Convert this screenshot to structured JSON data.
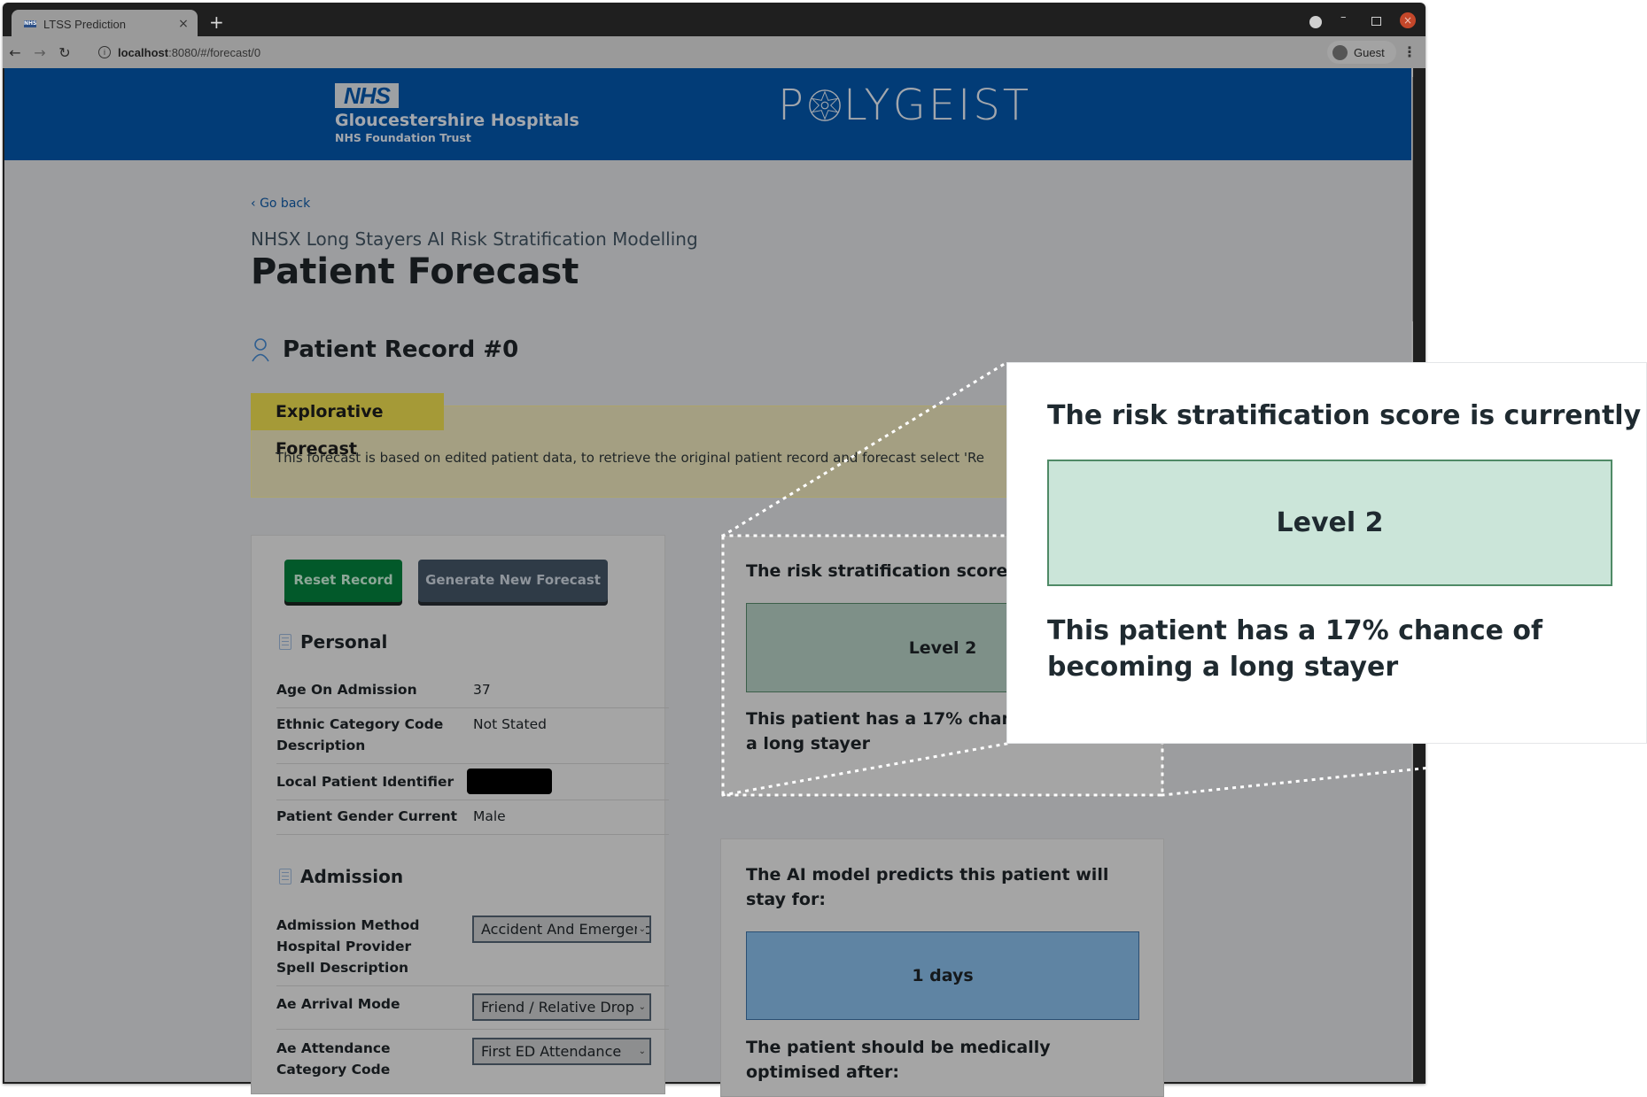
{
  "browser": {
    "tab_title": "LTSS Prediction",
    "tab_favicon_text": "NHS",
    "new_tab_label": "+",
    "url_host": "localhost",
    "url_rest": ":8080/#/forecast/0",
    "profile_label": "Guest"
  },
  "header": {
    "nhs_badge": "NHS",
    "org_name": "Gloucestershire Hospitals",
    "org_sub": "NHS Foundation Trust",
    "partner_logo": "POLYGEIST"
  },
  "page": {
    "go_back": "Go back",
    "subtitle": "NHSX Long Stayers AI Risk Stratification Modelling",
    "title": "Patient Forecast",
    "record_title": "Patient Record #0"
  },
  "explorative": {
    "tag": "Explorative Forecast",
    "text": "This forecast is based on edited patient data, to retrieve the original patient record and forecast select 'Re"
  },
  "actions": {
    "reset_label": "Reset Record",
    "generate_label": "Generate New Forecast"
  },
  "personal": {
    "heading": "Personal",
    "rows": [
      {
        "label": "Age On Admission",
        "value": "37"
      },
      {
        "label": "Ethnic Category Code Description",
        "value": "Not Stated"
      },
      {
        "label": "Local Patient Identifier",
        "value": "[redacted]"
      },
      {
        "label": "Patient Gender Current",
        "value": "Male"
      }
    ]
  },
  "admission": {
    "heading": "Admission",
    "rows": [
      {
        "label": "Admission Method Hospital Provider Spell Description",
        "selected": "Accident And Emergency"
      },
      {
        "label": "Ae Arrival Mode",
        "selected": "Friend / Relative Drop"
      },
      {
        "label": "Ae Attendance Category Code",
        "selected": "First ED Attendance"
      }
    ]
  },
  "risk": {
    "heading_truncated": "The risk stratification score is",
    "heading": "The risk stratification score is currently at:",
    "level": "Level 2",
    "chance_truncated_line1": "This patient has a 17% chance",
    "chance_truncated_line2": "a long stayer",
    "chance": "This patient has a 17% chance of becoming a long stayer",
    "chance_percent": 17
  },
  "stay": {
    "heading": "The AI model predicts this patient will stay for:",
    "days": "1 days",
    "optimised_heading": "The patient should be medically optimised after:"
  },
  "colors": {
    "nhs_blue": "#023c77",
    "reset_green": "#02592a",
    "level_green": "#cbe5d9",
    "days_blue": "#5f84a3",
    "explore_tag": "#a59a37"
  }
}
